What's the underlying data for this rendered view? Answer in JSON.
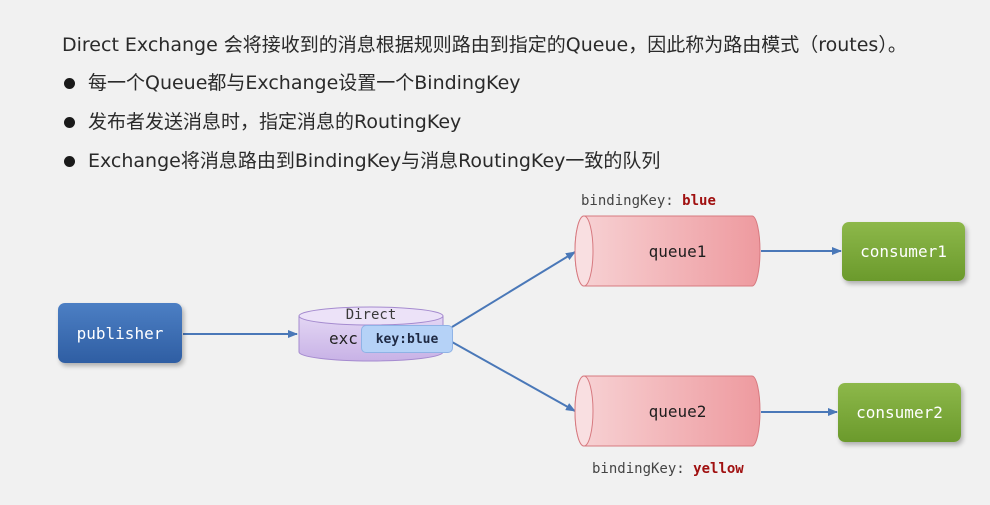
{
  "intro": "Direct Exchange 会将接收到的消息根据规则路由到指定的Queue，因此称为路由模式（routes）。",
  "bullets": [
    "每一个Queue都与Exchange设置一个BindingKey",
    "发布者发送消息时，指定消息的RoutingKey",
    "Exchange将消息路由到BindingKey与消息RoutingKey一致的队列"
  ],
  "diagram": {
    "publisher": "publisher",
    "exchange": {
      "type": "Direct",
      "name_visible": "exc"
    },
    "message_key": "key:blue",
    "queues": [
      {
        "name": "queue1",
        "binding_prefix": "bindingKey: ",
        "binding_value": "blue",
        "consumer": "consumer1"
      },
      {
        "name": "queue2",
        "binding_prefix": "bindingKey: ",
        "binding_value": "yellow",
        "consumer": "consumer2"
      }
    ],
    "colors": {
      "publisher": "#3c6db5",
      "consumer": "#7aa93a",
      "queue": "#f0a0a4",
      "exchange": "#d7c5ee",
      "key_tag": "#b5d2f7",
      "arrow": "#4a78b8",
      "binding_value": "#a01010"
    }
  }
}
